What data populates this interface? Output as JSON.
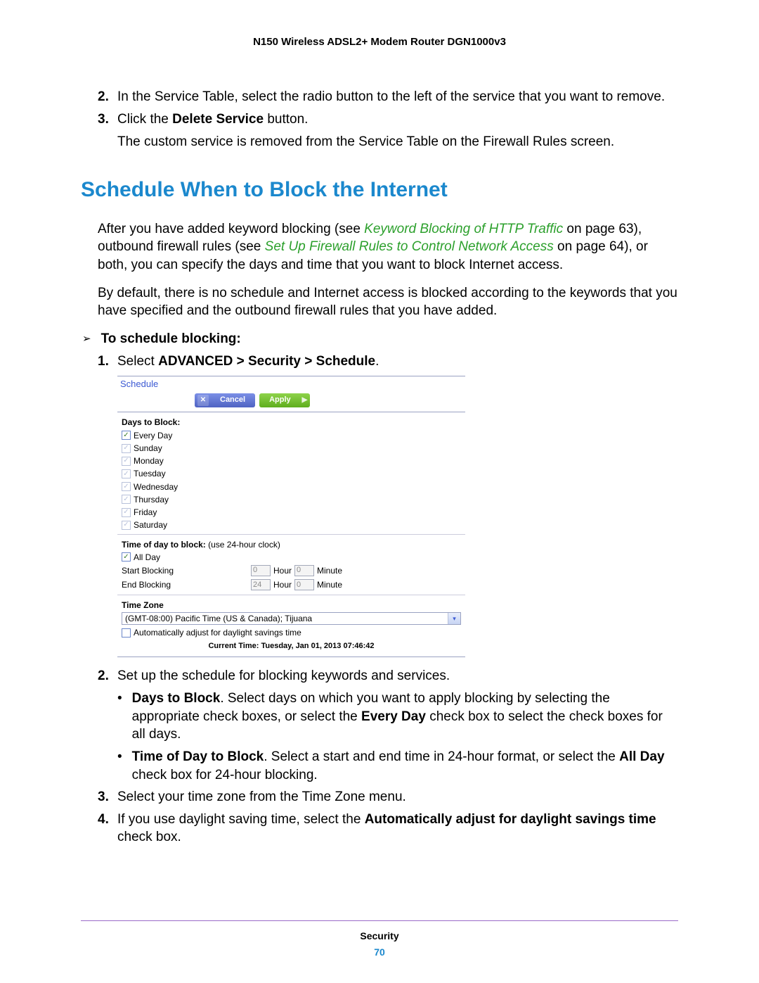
{
  "header": {
    "title": "N150 Wireless ADSL2+ Modem Router DGN1000v3"
  },
  "intro_steps": {
    "s2": {
      "num": "2.",
      "text": "In the Service Table, select the radio button to the left of the service that you want to remove."
    },
    "s3": {
      "num": "3.",
      "pre": "Click the ",
      "bold": "Delete Service",
      "post": " button.",
      "result": "The custom service is removed from the Service Table on the Firewall Rules screen."
    }
  },
  "heading": "Schedule When to Block the Internet",
  "para1": {
    "a": "After you have added keyword blocking (see ",
    "link1": "Keyword Blocking of HTTP Traffic",
    "b": " on page 63), outbound firewall rules (see ",
    "link2": "Set Up Firewall Rules to Control Network Access",
    "c": " on page 64), or both, you can specify the days and time that you want to block Internet access."
  },
  "para2": "By default, there is no schedule and Internet access is blocked according to the keywords that you have specified and the outbound firewall rules that you have added.",
  "proc": {
    "arrow": "➢",
    "title": "To schedule blocking:"
  },
  "steps": {
    "s1": {
      "num": "1.",
      "pre": "Select ",
      "bold": "ADVANCED > Security > Schedule",
      "post": "."
    },
    "s2": {
      "num": "2.",
      "text": "Set up the schedule for blocking keywords and services."
    },
    "s3": {
      "num": "3.",
      "text": "Select your time zone from the Time Zone menu."
    },
    "s4": {
      "num": "4.",
      "pre": "If you use daylight saving time, select the ",
      "bold": "Automatically adjust for daylight savings time",
      "post": " check box."
    }
  },
  "bullets": {
    "b1": {
      "dot": "•",
      "bold": "Days to Block",
      "text": ". Select days on which you want to apply blocking by selecting the appropriate check boxes, or select the ",
      "bold2": "Every Day",
      "text2": " check box to select the check boxes for all days."
    },
    "b2": {
      "dot": "•",
      "bold": "Time of Day to Block",
      "text": ". Select a start and end time in 24-hour format, or select the ",
      "bold2": "All Day",
      "text2": " check box for 24-hour blocking."
    }
  },
  "screenshot": {
    "title": "Schedule",
    "cancel": "Cancel",
    "apply": "Apply",
    "days_label": "Days to Block:",
    "days": {
      "every": "Every Day",
      "sun": "Sunday",
      "mon": "Monday",
      "tue": "Tuesday",
      "wed": "Wednesday",
      "thu": "Thursday",
      "fri": "Friday",
      "sat": "Saturday"
    },
    "time_label": "Time of day to block:",
    "time_note": " (use 24-hour clock)",
    "all_day": "All Day",
    "start": "Start Blocking",
    "end": "End Blocking",
    "start_hour": "0",
    "start_min": "0",
    "end_hour": "24",
    "end_min": "0",
    "hour_lbl": "Hour",
    "min_lbl": "Minute",
    "tz_label": "Time Zone",
    "tz_value": "(GMT-08:00) Pacific Time (US & Canada); Tijuana",
    "auto_dst": "Automatically adjust for daylight savings time",
    "current_time": "Current Time: Tuesday, Jan 01, 2013 07:46:42"
  },
  "footer": {
    "section": "Security",
    "page": "70"
  }
}
